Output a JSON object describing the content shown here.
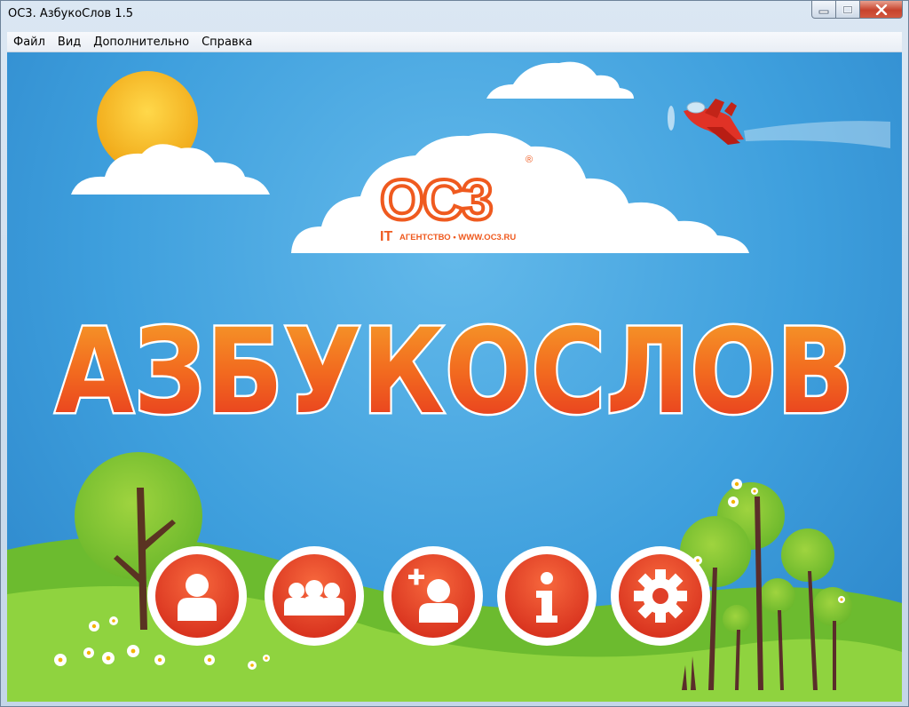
{
  "window": {
    "title": "ОС3. АзбукоСлов 1.5",
    "controls": {
      "minimize": "minimize-icon",
      "maximize": "maximize-icon",
      "close": "close-icon"
    }
  },
  "menu": {
    "items": [
      "Файл",
      "Вид",
      "Дополнительно",
      "Справка"
    ]
  },
  "hero": {
    "logo_main": "ОС3",
    "logo_registered": "®",
    "logo_it": "IT",
    "logo_subtitle": "АГЕНТСТВО • WWW.OC3.RU",
    "app_title": "АЗБУКОСЛОВ"
  },
  "nav_buttons": [
    {
      "icon": "user-icon"
    },
    {
      "icon": "group-icon"
    },
    {
      "icon": "add-user-icon"
    },
    {
      "icon": "info-icon"
    },
    {
      "icon": "gear-icon"
    }
  ],
  "colors": {
    "sky": "#3e9fdd",
    "title_orange": "#f26a1f",
    "title_red": "#e52f1f",
    "button_red": "#e8442c",
    "grass": "#7ec63a",
    "sun": "#f8c42a"
  }
}
